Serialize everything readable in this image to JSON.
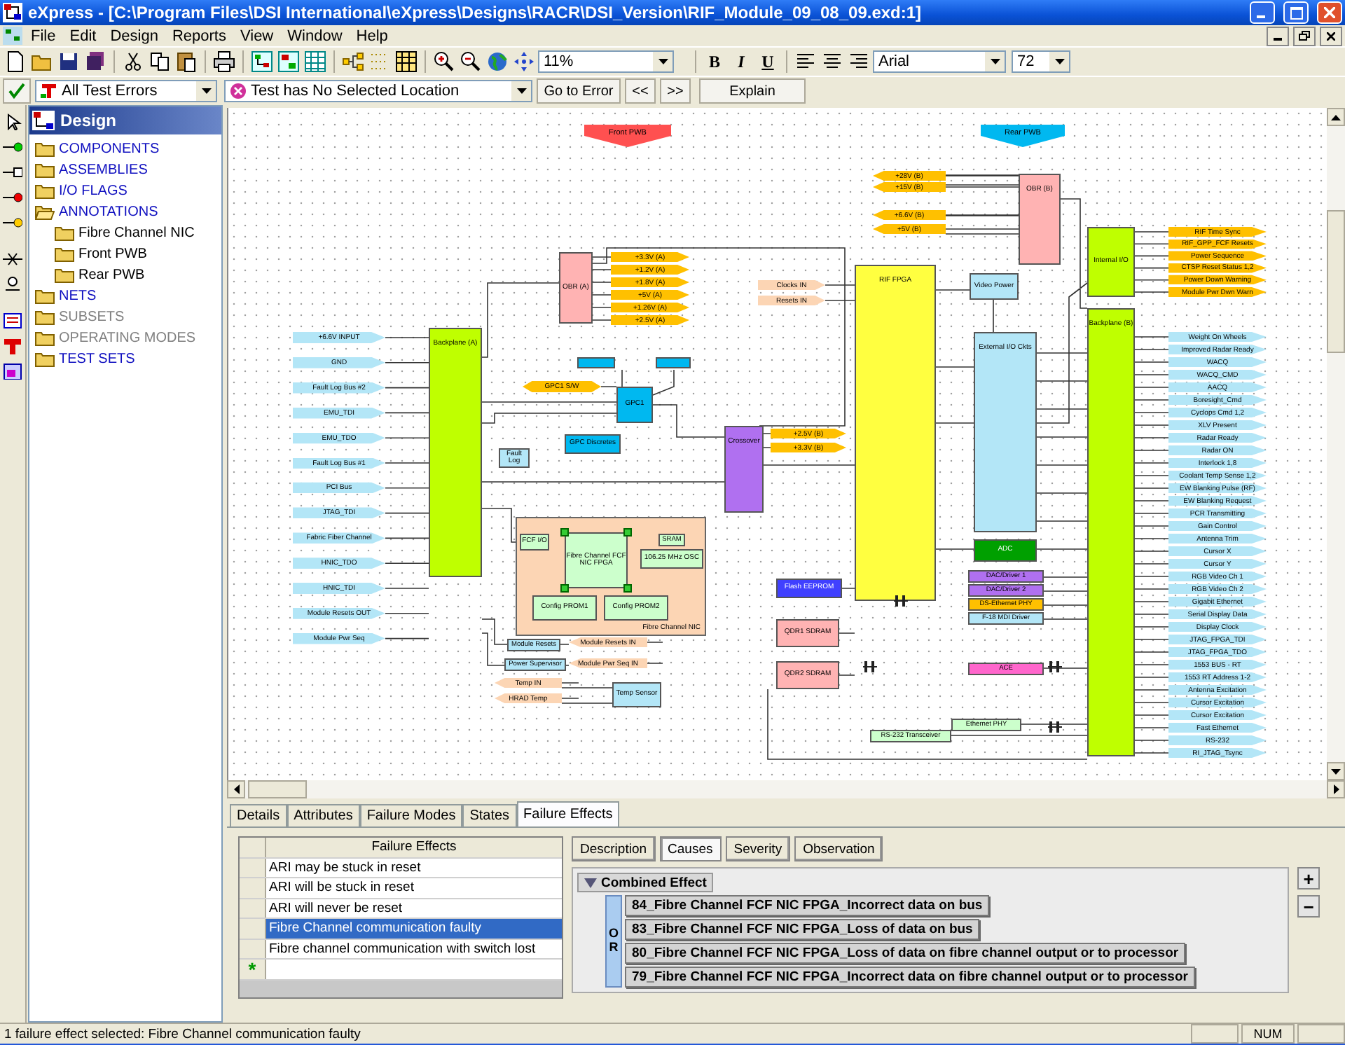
{
  "window": {
    "title": "eXpress - [C:\\Program Files\\DSI International\\eXpress\\Designs\\RACR\\DSI_Version\\RIF_Module_09_08_09.exd:1]"
  },
  "menu": [
    "File",
    "Edit",
    "Design",
    "Reports",
    "View",
    "Window",
    "Help"
  ],
  "toolbar": {
    "zoom": "11%",
    "bold": "B",
    "italic": "I",
    "underline": "U",
    "font": "Arial",
    "font_size": "72"
  },
  "test_bar": {
    "filter": "All Test Errors",
    "location": "Test has No Selected Location",
    "buttons": [
      "Go to Error",
      "<<",
      ">>",
      "Explain"
    ]
  },
  "design_panel": {
    "title": "Design",
    "items": [
      {
        "label": "COMPONENTS",
        "disabled": false,
        "expanded": false
      },
      {
        "label": "ASSEMBLIES",
        "disabled": false,
        "expanded": false
      },
      {
        "label": "I/O FLAGS",
        "disabled": false,
        "expanded": false
      },
      {
        "label": "ANNOTATIONS",
        "disabled": false,
        "expanded": true,
        "children": [
          {
            "label": "Fibre Channel NIC",
            "disabled": false,
            "expanded": false
          },
          {
            "label": "Front PWB",
            "disabled": false,
            "expanded": false
          },
          {
            "label": "Rear PWB",
            "disabled": false,
            "expanded": false
          }
        ]
      },
      {
        "label": "NETS",
        "disabled": false,
        "expanded": false
      },
      {
        "label": "SUBSETS",
        "disabled": true,
        "expanded": false
      },
      {
        "label": "OPERATING MODES",
        "disabled": true,
        "expanded": false
      },
      {
        "label": "TEST SETS",
        "disabled": false,
        "expanded": false
      }
    ]
  },
  "canvas": {
    "offpage": [
      {
        "label": "Front PWB",
        "color": "#ff5050"
      },
      {
        "label": "Rear PWB",
        "color": "#00b8f0"
      }
    ],
    "blocks": [
      {
        "label": "OBR (B)",
        "color": "#ffb3b3",
        "kind": "block",
        "selected": false
      },
      {
        "label": "Internal I/O",
        "color": "#bfff00",
        "kind": "block",
        "selected": false
      },
      {
        "label": "OBR (A)",
        "color": "#ffb3b3",
        "kind": "block",
        "selected": false
      },
      {
        "label": "RIF FPGA",
        "color": "#ffff40",
        "kind": "block",
        "selected": false
      },
      {
        "label": "Video Power",
        "color": "#b3e6f7",
        "kind": "block",
        "selected": false
      },
      {
        "label": "Backplane (B)",
        "color": "#bfff00",
        "kind": "block",
        "selected": false
      },
      {
        "label": "Backplane (A)",
        "color": "#bfff00",
        "kind": "block",
        "selected": false
      },
      {
        "label": "External I/O Ckts",
        "color": "#b3e6f7",
        "kind": "block",
        "selected": false
      },
      {
        "color": "#00b8f0",
        "kind": "block",
        "selected": false
      },
      {
        "color": "#00b8f0",
        "kind": "block",
        "selected": false
      },
      {
        "label": "GPC1",
        "color": "#00b8f0",
        "kind": "block",
        "selected": false
      },
      {
        "label": "GPC Discretes",
        "color": "#00b8f0",
        "kind": "block",
        "selected": false
      },
      {
        "label": "Crossover",
        "color": "#b070f0",
        "kind": "block",
        "selected": false
      },
      {
        "label": "Fault Log",
        "color": "#b3e6f7",
        "kind": "block",
        "selected": false
      },
      {
        "label": "FCF I/O",
        "color": "#ccffcc",
        "kind": "block",
        "selected": false
      },
      {
        "label": "Fibre Channel FCF NIC FPGA",
        "color": "#ccffcc",
        "kind": "block",
        "selected": true
      },
      {
        "label": "SRAM",
        "color": "#ccffcc",
        "kind": "block",
        "selected": false
      },
      {
        "label": "106.25 MHz OSC",
        "color": "#ccffcc",
        "kind": "block",
        "selected": false
      },
      {
        "label": "ADC",
        "color": "#00a000",
        "kind": "block",
        "selected": false
      },
      {
        "label": "Flash EEPROM",
        "color": "#4040ff",
        "kind": "block",
        "selected": false
      },
      {
        "label": "DAC/Driver 1",
        "color": "#b070f0",
        "kind": "block",
        "selected": false
      },
      {
        "label": "DAC/Driver 2",
        "color": "#b070f0",
        "kind": "block",
        "selected": false
      },
      {
        "label": "Config PROM1",
        "color": "#ccffcc",
        "kind": "block",
        "selected": false
      },
      {
        "label": "Config PROM2",
        "color": "#ccffcc",
        "kind": "block",
        "selected": false
      },
      {
        "label": "DS-Ethernet PHY",
        "color": "#ffc000",
        "kind": "block",
        "selected": false
      },
      {
        "label": "F-18 MDI Driver",
        "color": "#b3e6f7",
        "kind": "block",
        "selected": false
      },
      {
        "label": "Fibre Channel NIC",
        "color": "#fcd5b4",
        "kind": "group",
        "selected": false
      },
      {
        "label": "QDR1 SDRAM",
        "color": "#ffb3b3",
        "kind": "block",
        "selected": false
      },
      {
        "label": "Module Resets",
        "color": "#b3e6f7",
        "kind": "block",
        "selected": false
      },
      {
        "label": "Power Supervisor",
        "color": "#b3e6f7",
        "kind": "block",
        "selected": false
      },
      {
        "label": "QDR2 SDRAM",
        "color": "#ffb3b3",
        "kind": "block",
        "selected": false
      },
      {
        "label": "ACE",
        "color": "#ff66cc",
        "kind": "block",
        "selected": false
      },
      {
        "label": "Temp Sensor",
        "color": "#b3e6f7",
        "kind": "block",
        "selected": false
      },
      {
        "label": "Ethernet PHY",
        "color": "#ccffcc",
        "kind": "block",
        "selected": false
      },
      {
        "label": "RS-232 Transceiver",
        "color": "#ccffcc",
        "kind": "block",
        "selected": false
      }
    ],
    "port_groups": [
      {
        "color": "#b3e6f7",
        "ports": [
          "+6.6V INPUT",
          "GND",
          "Fault Log Bus #2",
          "EMU_TDI",
          "EMU_TDO",
          "Fault Log Bus #1",
          "PCI Bus",
          "JTAG_TDI",
          "Fabric Fiber Channel",
          "HNIC_TDO",
          "HNIC_TDI",
          "Module Resets OUT",
          "Module Pwr Seq"
        ]
      },
      {
        "color": "#ffc000",
        "ports": [
          "+3.3V (A)",
          "+1.2V (A)",
          "+1.8V (A)",
          "+5V (A)",
          "+1.26V (A)",
          "+2.5V (A)"
        ]
      },
      {
        "color": "#ffc000",
        "ports": [
          "GPC1 S/W"
        ]
      },
      {
        "color": "#ffc000",
        "ports": [
          "+2.5V (B)",
          "+3.3V (B)"
        ]
      },
      {
        "color": "#fcd5b4",
        "ports": [
          "Module Resets IN",
          "Module Pwr Seq IN"
        ]
      },
      {
        "color": "#fcd5b4",
        "ports": [
          "Temp IN",
          "HRAD Temp"
        ]
      },
      {
        "color": "#fcd5b4",
        "ports": [
          "Clocks IN",
          "Resets IN"
        ]
      },
      {
        "color": "#ffc000",
        "ports": [
          "+28V (B)",
          "+15V (B)"
        ]
      },
      {
        "color": "#ffc000",
        "ports": [
          "+6.6V (B)",
          "+5V (B)"
        ]
      },
      {
        "color": "#ffc000",
        "ports": [
          "RIF Time Sync",
          "RIF_GPP_FCF Resets",
          "Power Sequence",
          "CTSP Reset Status 1,2",
          "Power Down Warning",
          "Module Pwr Dwn Warn"
        ]
      },
      {
        "color": "#b3e6f7",
        "ports": [
          "Weight On Wheels",
          "Improved Radar Ready",
          "WACQ",
          "WACQ_CMD",
          "AACQ",
          "Boresight_Cmd",
          "Cyclops Cmd 1,2",
          "XLV Present",
          "Radar Ready",
          "Radar ON",
          "Interlock 1,8",
          "Coolant Temp Sense 1,2",
          "EW Blanking Pulse (RF)",
          "EW Blanking Request",
          "PCR Transmitting",
          "Gain Control",
          "Antenna Trim",
          "Cursor X",
          "Cursor Y",
          "RGB Video Ch 1",
          "RGB Video Ch 2",
          "Gigabit Ethernet",
          "Serial Display Data",
          "Display Clock",
          "JTAG_FPGA_TDI",
          "JTAG_FPGA_TDO",
          "1553 BUS - RT",
          "1553 RT Address 1-2",
          "Antenna Excitation",
          "Cursor Excitation",
          "Cursor Excitation",
          "Fast Ethernet",
          "RS-232",
          "RI_JTAG_Tsync"
        ]
      }
    ]
  },
  "bottom_tabs": [
    {
      "label": "Details",
      "selected": false
    },
    {
      "label": "Attributes",
      "selected": false
    },
    {
      "label": "Failure Modes",
      "selected": false
    },
    {
      "label": "States",
      "selected": false
    },
    {
      "label": "Failure Effects",
      "selected": true
    }
  ],
  "failure_effects": {
    "header": "Failure Effects",
    "new_row_marker": "*",
    "rows": [
      {
        "text": "ARI may be stuck in reset",
        "selected": false
      },
      {
        "text": "ARI will be stuck in reset",
        "selected": false
      },
      {
        "text": "ARI will never be reset",
        "selected": false
      },
      {
        "text": "Fibre Channel communication faulty",
        "selected": true
      },
      {
        "text": "Fibre channel communication with switch lost",
        "selected": false
      }
    ]
  },
  "cause_tabs": [
    {
      "label": "Description",
      "selected": false
    },
    {
      "label": "Causes",
      "selected": true
    },
    {
      "label": "Severity",
      "selected": false
    },
    {
      "label": "Observation",
      "selected": false
    }
  ],
  "causes": {
    "title": "Combined Effect",
    "expanded": true,
    "operator": "OR",
    "items": [
      "84_Fibre Channel FCF NIC FPGA_Incorrect data on bus",
      "83_Fibre Channel FCF NIC FPGA_Loss of data on bus",
      "80_Fibre Channel FCF NIC FPGA_Loss of data on fibre channel output or to processor",
      "79_Fibre Channel FCF NIC FPGA_Incorrect data on fibre channel output or to processor"
    ]
  },
  "zoom_buttons": [
    "+",
    "−"
  ],
  "status_bar": {
    "message": "1 failure effect selected: Fibre Channel communication faulty",
    "indicator": "NUM"
  }
}
